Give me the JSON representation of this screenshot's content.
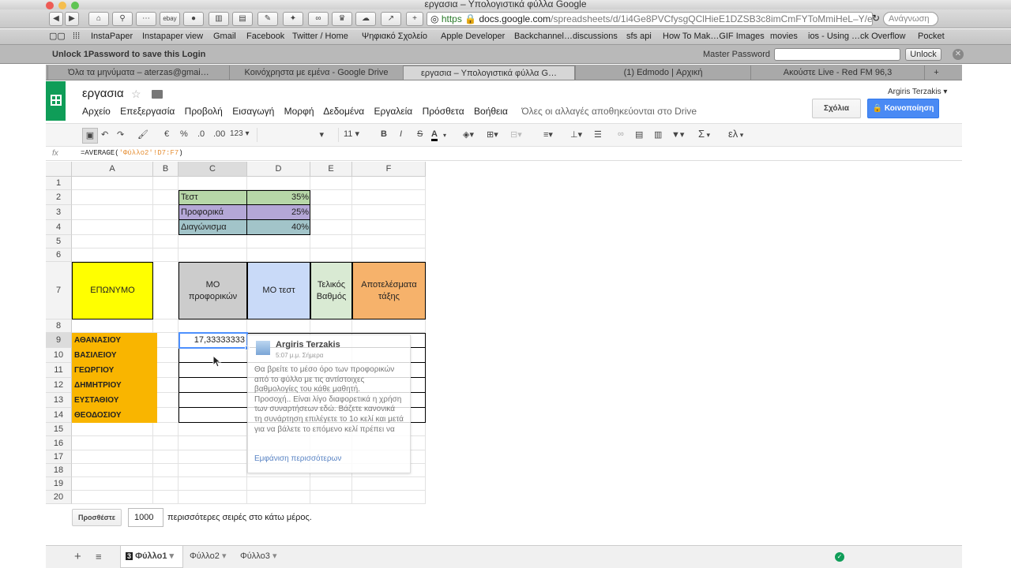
{
  "window": {
    "title": "εργασια – Υπολογιστικά φύλλα Google"
  },
  "browser": {
    "url": "https",
    "url_domain": "docs.google.com",
    "url_path": "/spreadsheets/d/1i4Ge8PVCfysgQClHieE1DZSB3c8imCmFYToMmiHeL–Y/edit#gid",
    "search_placeholder": "Ανάγνωση",
    "bookmarks": [
      "InstaPaper",
      "Instapaper view",
      "Gmail",
      "Facebook",
      "Twitter / Home",
      "Ψηφιακό Σχολείο",
      "Apple Developer",
      "Backchannel…discussions",
      "sfs api",
      "How To Mak…GIF Images",
      "movies",
      "ios - Using …ck Overflow",
      "Pocket"
    ],
    "tabs": [
      "Όλα τα μηνύματα – aterzas@gmai…",
      "Κοινόχρηστα με εμένα - Google Drive",
      "εργασια – Υπολογιστικά φύλλα G…",
      "(1) Edmodo | Αρχική",
      "Ακούστε Live - Red FM 96,3"
    ],
    "toolbar_buttons": [
      "ebay"
    ]
  },
  "onepassword": {
    "message": "Unlock 1Password to save this Login",
    "label": "Master Password",
    "unlock": "Unlock"
  },
  "docs": {
    "title": "εργασια",
    "user": "Argiris Terzakis",
    "menu": [
      "Αρχείο",
      "Επεξεργασία",
      "Προβολή",
      "Εισαγωγή",
      "Μορφή",
      "Δεδομένα",
      "Εργαλεία",
      "Πρόσθετα",
      "Βοήθεια"
    ],
    "save_status": "Όλες οι αλλαγές αποθηκεύονται στο Drive",
    "comments_button": "Σχόλια",
    "share_button": "Κοινοποίηση"
  },
  "format_toolbar": {
    "currency": "€",
    "percent": "%",
    "dec_less": ".0",
    "dec_more": ".00",
    "more_formats": "123",
    "font_size": "11",
    "bold": "B",
    "italic": "I",
    "strike": "S",
    "text_color": "A",
    "sum": "Σ",
    "input_lang": "ελ"
  },
  "formula": {
    "fx": "fx",
    "prefix": "=AVERAGE(",
    "ref": "'Φύλλο2'!D7:F7",
    "suffix": ")"
  },
  "columns": [
    "A",
    "B",
    "C",
    "D",
    "E",
    "F"
  ],
  "rows": [
    "1",
    "2",
    "3",
    "4",
    "5",
    "6",
    "7",
    "8",
    "9",
    "10",
    "11",
    "12",
    "13",
    "14",
    "15",
    "16",
    "17",
    "18",
    "19",
    "20"
  ],
  "weights": [
    {
      "label": "Τεστ",
      "value": "35%",
      "color": "#b7d7a8"
    },
    {
      "label": "Προφορικά",
      "value": "25%",
      "color": "#b4a7d6"
    },
    {
      "label": "Διαγώνισμα",
      "value": "40%",
      "color": "#a2c4c9"
    }
  ],
  "headers": {
    "surname": "ΕΠΩΝΥΜΟ",
    "oral_avg": "ΜΟ προφορικών",
    "test_avg": "ΜΟ τεστ",
    "final": "Τελικός Βαθμός",
    "class_results": "Αποτελέσματα τάξης"
  },
  "students": [
    "ΑΘΑΝΑΣΙΟΥ",
    "ΒΑΣΙΛΕΙΟΥ",
    "ΓΕΩΡΓΙΟΥ",
    "ΔΗΜΗΤΡΙΟΥ",
    "ΕΥΣΤΑΘΙΟΥ",
    "ΘΕΟΔΟΣΙΟΥ"
  ],
  "selected_value": "17,33333333",
  "comment": {
    "author": "Argiris Terzakis",
    "time": "5:07 μ.μ. Σήμερα",
    "body": "Θα βρείτε το μέσο όρο των προφορικών από το φύλλο με τις αντίστοιχες βαθμολογίες του κάθε μαθητή.\nΠροσοχή.. Είναι λίγο διαφορετικά η χρήση των συναρτήσεων εδώ. Βάζετε κανονικά τη συνάρτηση επιλέγετε το 1ο κελί και μετά για να βάλετε το επόμενο κελί πρέπει να",
    "more": "Εμφάνιση περισσότερων"
  },
  "add_rows": {
    "button": "Προσθέστε",
    "count": "1000",
    "suffix": "περισσότερες σειρές στο κάτω μέρος."
  },
  "sheets": [
    {
      "name": "Φύλλο1",
      "badge": "3"
    },
    {
      "name": "Φύλλο2"
    },
    {
      "name": "Φύλλο3"
    }
  ]
}
